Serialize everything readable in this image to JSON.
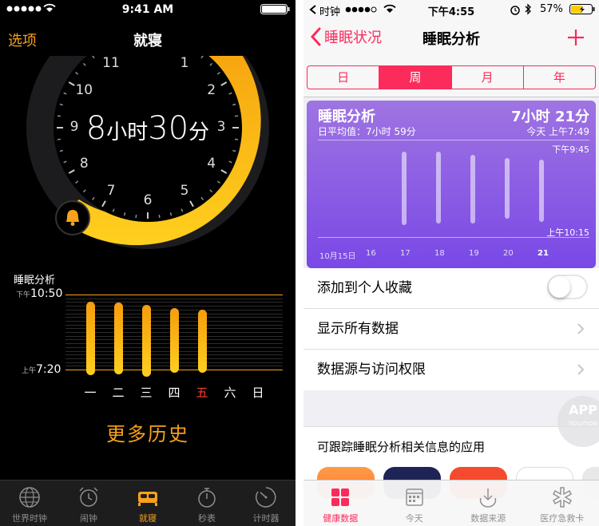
{
  "left": {
    "status": {
      "time": "9:41 AM"
    },
    "nav": {
      "back_label": "选项",
      "title": "就寝"
    },
    "clock": {
      "duration_hours": "8",
      "duration_hours_unit": "小时",
      "duration_minutes": "30",
      "duration_minutes_unit": "分",
      "numbers": [
        "12",
        "1",
        "2",
        "3",
        "4",
        "5",
        "6",
        "7",
        "8",
        "9",
        "10",
        "11"
      ]
    },
    "sleep_chart": {
      "title": "睡眠分析",
      "top_prefix": "下午",
      "top_time": "10:50",
      "bottom_prefix": "上午",
      "bottom_time": "7:20",
      "days": [
        "一",
        "二",
        "三",
        "四",
        "五",
        "六",
        "日"
      ],
      "highlight_day": "五"
    },
    "more_history": "更多历史",
    "tabs": [
      {
        "label": "世界时钟",
        "icon": "globe-icon"
      },
      {
        "label": "闹钟",
        "icon": "alarm-clock-icon"
      },
      {
        "label": "就寝",
        "icon": "bed-icon",
        "active": true
      },
      {
        "label": "秒表",
        "icon": "stopwatch-icon"
      },
      {
        "label": "计时器",
        "icon": "timer-icon"
      }
    ],
    "accent_color": "#f7a21b"
  },
  "right": {
    "status": {
      "carrier": "时钟",
      "time": "下午4:55",
      "battery": "57%"
    },
    "nav": {
      "back_label": "睡眠状况",
      "title": "睡眠分析",
      "add_label": "+"
    },
    "segments": [
      "日",
      "周",
      "月",
      "年"
    ],
    "selected_segment": "周",
    "card": {
      "title": "睡眠分析",
      "avg_label": "日平均值：7小时 59分",
      "total": "7小时 21分",
      "date_time": "今天 上午7:49",
      "top_time": "下午9:45",
      "bottom_time": "上午10:15",
      "x_labels": [
        "10月15日",
        "16",
        "17",
        "18",
        "19",
        "20",
        "21"
      ]
    },
    "rows": {
      "favorite": "添加到个人收藏",
      "show_all": "显示所有数据",
      "sources": "数据源与访问权限"
    },
    "apps_title": "可跟踪睡眠分析相关信息的应用",
    "watermark": {
      "main": "APP",
      "sub": "SOLUTION"
    },
    "tabs": [
      {
        "label": "健康数据",
        "icon": "health-data-icon",
        "active": true
      },
      {
        "label": "今天",
        "icon": "calendar-icon"
      },
      {
        "label": "数据来源",
        "icon": "sources-icon"
      },
      {
        "label": "医疗急救卡",
        "icon": "medical-id-icon"
      }
    ],
    "accent_color": "#fb2b5b"
  }
}
